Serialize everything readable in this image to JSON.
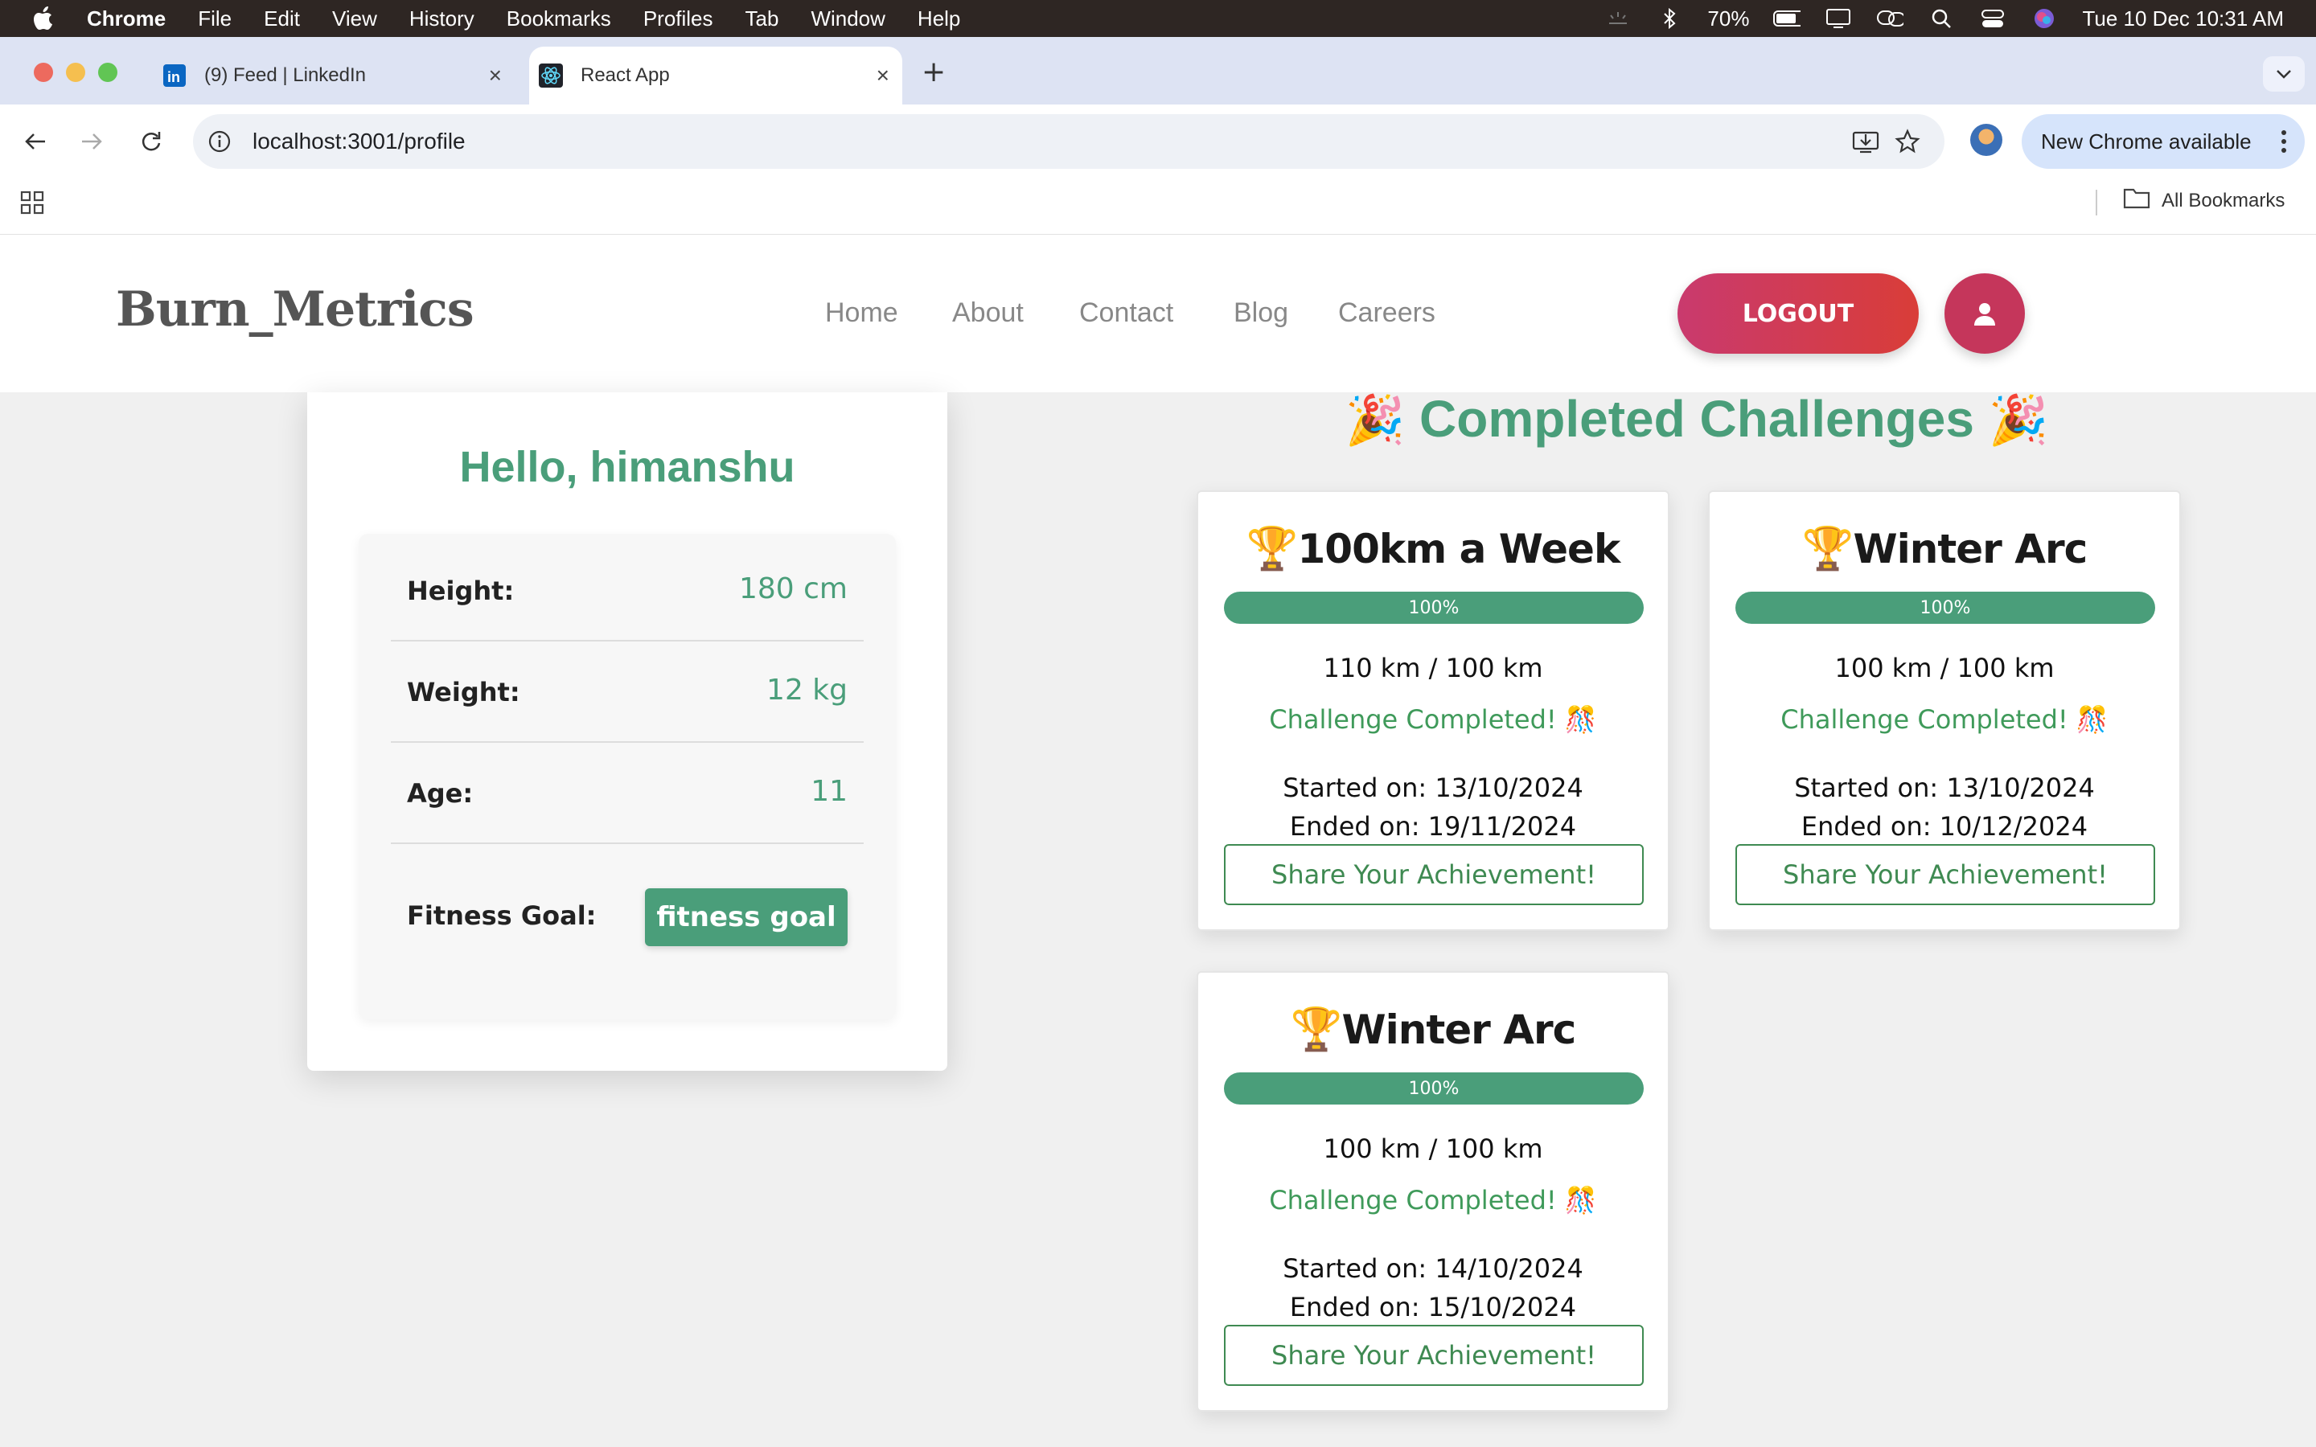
{
  "menubar": {
    "app": "Chrome",
    "items": [
      "File",
      "Edit",
      "View",
      "History",
      "Bookmarks",
      "Profiles",
      "Tab",
      "Window",
      "Help"
    ],
    "battery": "70%",
    "datetime": "Tue 10 Dec  10:31 AM"
  },
  "tabs": {
    "inactive_title": "(9) Feed | LinkedIn",
    "active_title": "React App"
  },
  "toolbar": {
    "url": "localhost:3001/profile",
    "update_label": "New Chrome available"
  },
  "bookmarks": {
    "all_label": "All Bookmarks"
  },
  "site": {
    "brand": "Burn_Metrics",
    "nav": [
      "Home",
      "About",
      "Contact",
      "Blog",
      "Careers"
    ],
    "logout_label": "LOGOUT"
  },
  "profile": {
    "greeting": "Hello, himanshu",
    "stats": [
      {
        "label": "Height:",
        "value": "180 cm"
      },
      {
        "label": "Weight:",
        "value": "12 kg"
      },
      {
        "label": "Age:",
        "value": "11"
      }
    ],
    "goal_label": "Fitness Goal:",
    "goal_value": "fitness goal"
  },
  "challenges": {
    "heading": "Completed Challenges",
    "items": [
      {
        "name": "100km a Week",
        "progress": "100%",
        "distance": "110 km / 100 km",
        "status": "Challenge Completed! 🎊",
        "started": "Started on: 13/10/2024",
        "ended": "Ended on: 19/11/2024",
        "share": "Share Your Achievement!"
      },
      {
        "name": "Winter Arc",
        "progress": "100%",
        "distance": "100 km / 100 km",
        "status": "Challenge Completed! 🎊",
        "started": "Started on: 13/10/2024",
        "ended": "Ended on: 10/12/2024",
        "share": "Share Your Achievement!"
      },
      {
        "name": "Winter Arc",
        "progress": "100%",
        "distance": "100 km / 100 km",
        "status": "Challenge Completed! 🎊",
        "started": "Started on: 14/10/2024",
        "ended": "Ended on: 15/10/2024",
        "share": "Share Your Achievement!"
      }
    ]
  },
  "colors": {
    "accent_green": "#4a9e7a",
    "logout_red": "#d93d38",
    "user_button": "#c5365b"
  },
  "icons": [
    "apple-icon",
    "bluetooth-icon",
    "battery-icon",
    "search-icon",
    "control-center-icon",
    "siri-icon",
    "linkedin-icon",
    "react-icon",
    "back-icon",
    "forward-icon",
    "reload-icon",
    "info-icon",
    "install-icon",
    "star-icon",
    "apps-grid-icon",
    "folder-icon",
    "user-icon",
    "trophy-icon",
    "party-popper-icon"
  ]
}
